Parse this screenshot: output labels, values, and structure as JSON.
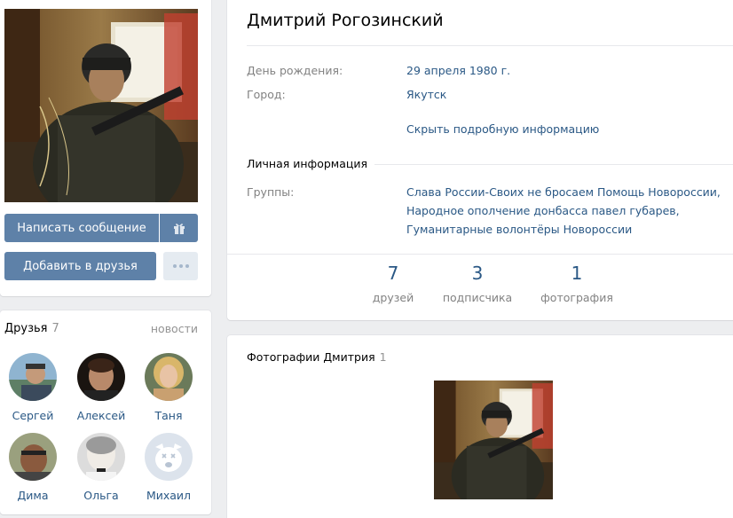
{
  "profile": {
    "name": "Дмитрий Рогозинский",
    "birthday_label": "День рождения:",
    "birthday_value": "29 апреля 1980 г.",
    "city_label": "Город:",
    "city_value": "Якутск",
    "hide_info_link": "Скрыть подробную информацию",
    "personal_section": "Личная информация",
    "groups_label": "Группы:",
    "groups": [
      "Слава России-Своих не бросаем Помощь Новороссии,",
      "Народное ополчение донбасса павел губарев,",
      "Гуманитарные волонтёры Новороссии"
    ]
  },
  "buttons": {
    "message": "Написать сообщение",
    "add_friend": "Добавить в друзья",
    "gift_icon": "gift-icon",
    "more_icon": "more-dots-icon"
  },
  "stats": [
    {
      "num": "7",
      "caption": "друзей"
    },
    {
      "num": "3",
      "caption": "подписчика"
    },
    {
      "num": "1",
      "caption": "фотография"
    }
  ],
  "friends": {
    "title": "Друзья",
    "count": "7",
    "news": "новости",
    "items": [
      {
        "name": "Сергей"
      },
      {
        "name": "Алексей"
      },
      {
        "name": "Таня"
      },
      {
        "name": "Дима"
      },
      {
        "name": "Ольга"
      },
      {
        "name": "Михаил"
      }
    ]
  },
  "photos": {
    "title": "Фотографии Дмитрия",
    "count": "1"
  },
  "colors": {
    "accent": "#5e81a8",
    "link": "#2a5885",
    "muted": "#828282",
    "page_bg": "#edeef0"
  }
}
